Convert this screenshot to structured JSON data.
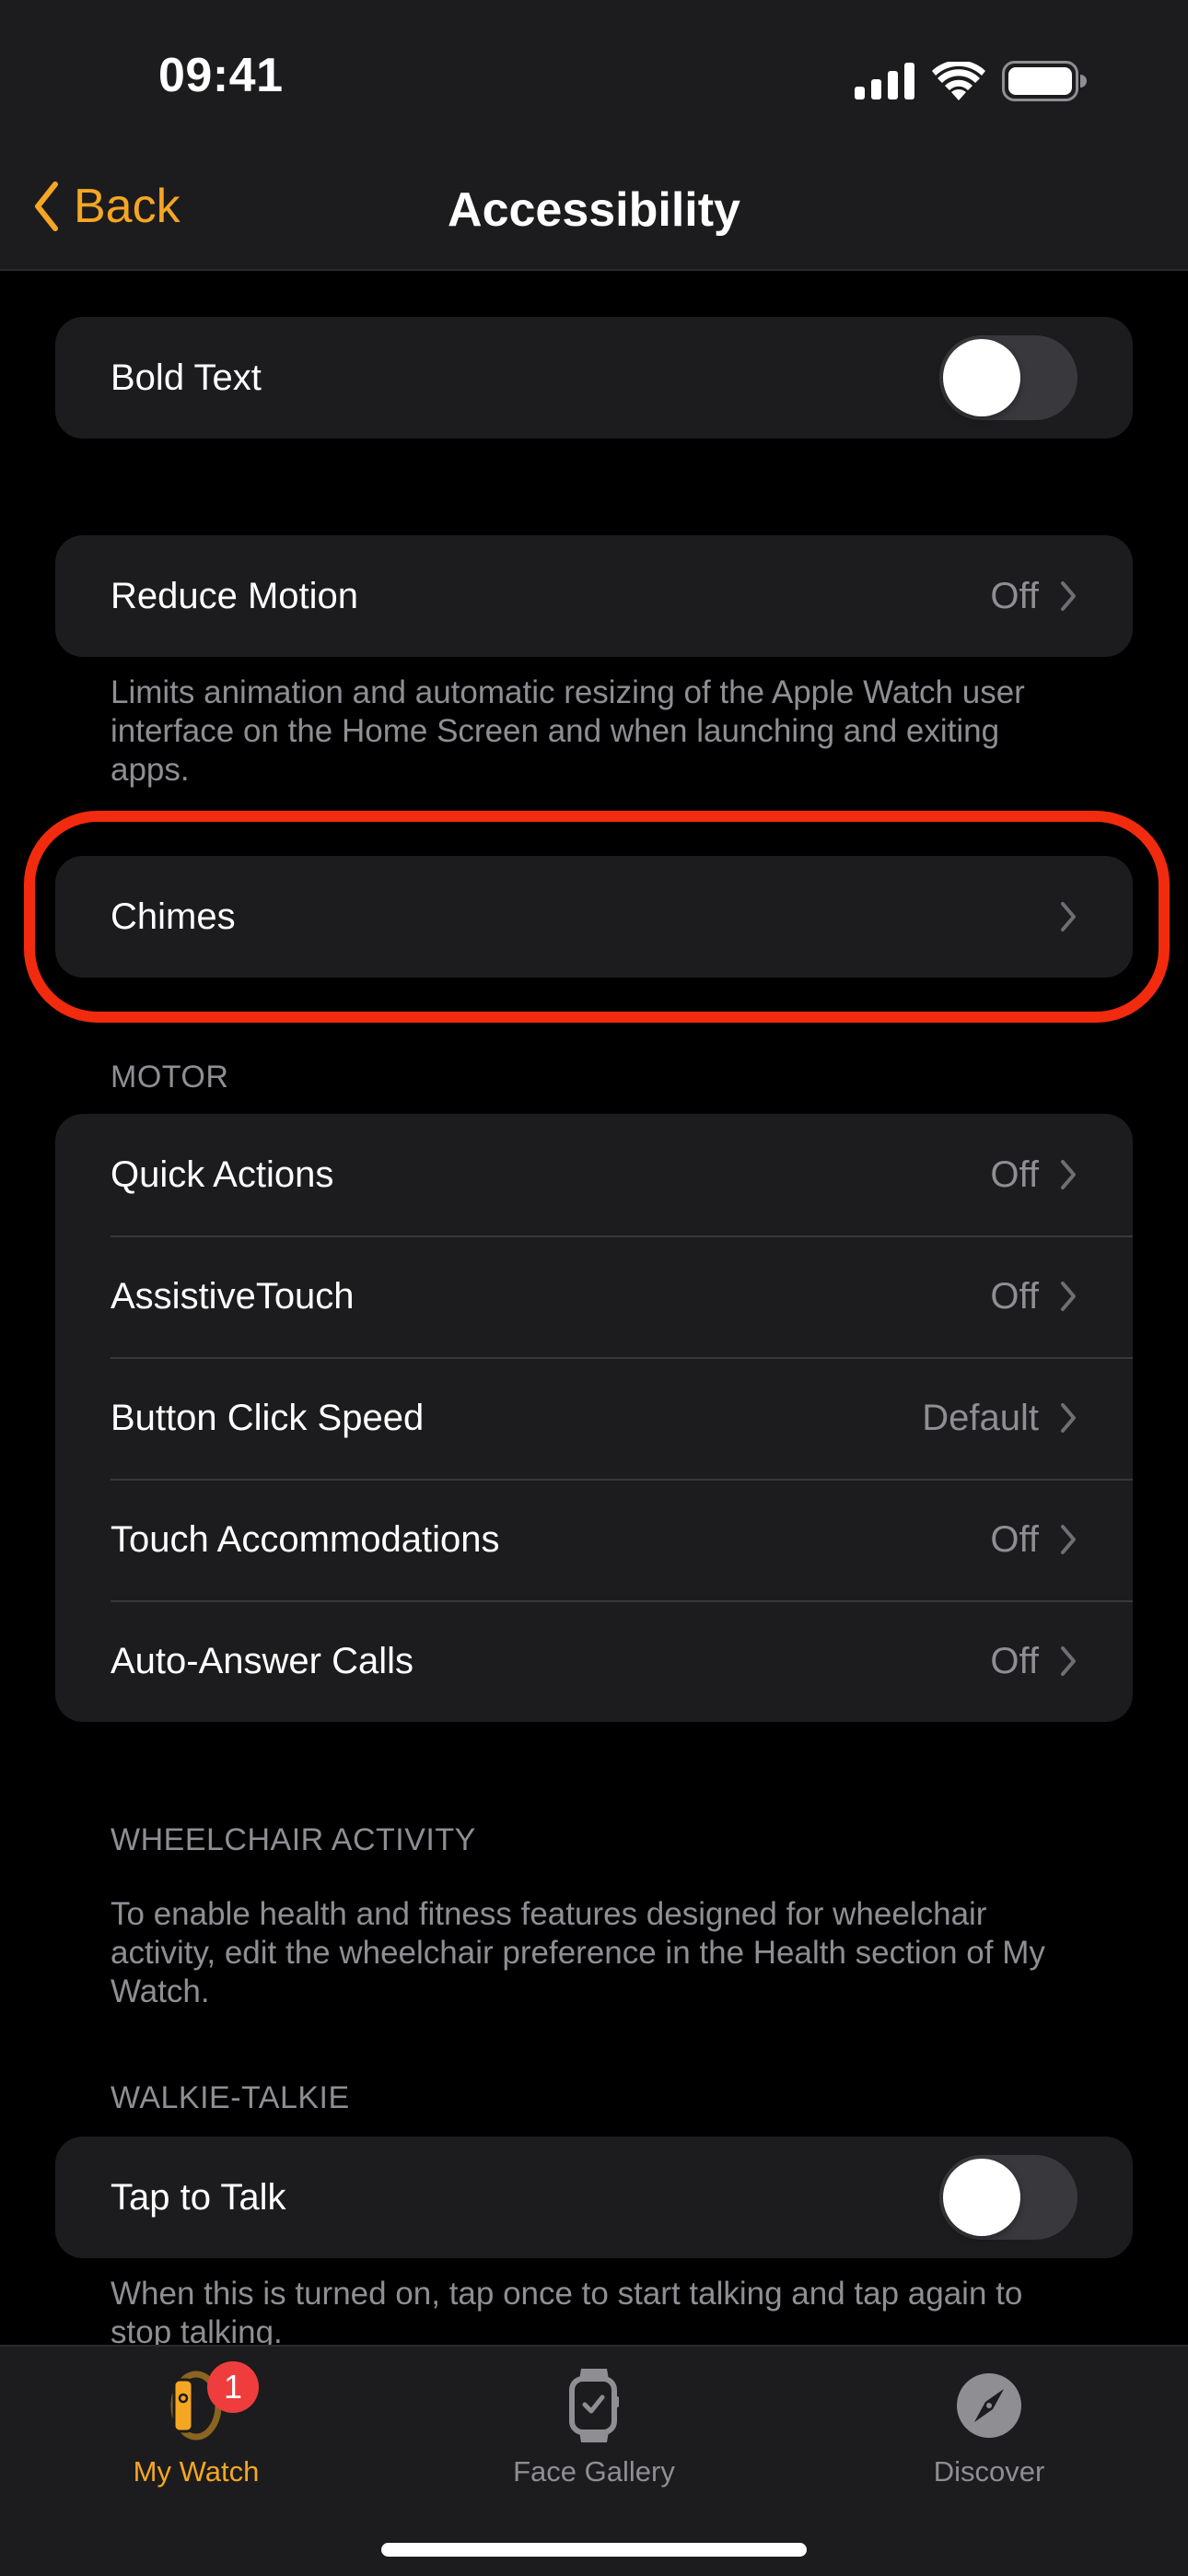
{
  "status_bar": {
    "time": "09:41",
    "icons": [
      "cellular-signal-icon",
      "wifi-icon",
      "battery-icon"
    ]
  },
  "nav": {
    "back_label": "Back",
    "title": "Accessibility"
  },
  "colors": {
    "accent": "#f5a623",
    "highlight": "#f22b0e",
    "badge": "#ef3d3d",
    "secondary_text": "#8e8e93",
    "cell_bg": "#1c1c1e"
  },
  "bold_text": {
    "label": "Bold Text",
    "enabled": false
  },
  "reduce_motion": {
    "label": "Reduce Motion",
    "value": "Off",
    "footer": "Limits animation and automatic resizing of the Apple Watch user interface on the Home Screen and when launching and exiting apps."
  },
  "chimes": {
    "label": "Chimes",
    "highlighted": true
  },
  "motor": {
    "header": "MOTOR",
    "items": [
      {
        "label": "Quick Actions",
        "value": "Off"
      },
      {
        "label": "AssistiveTouch",
        "value": "Off"
      },
      {
        "label": "Button Click Speed",
        "value": "Default"
      },
      {
        "label": "Touch Accommodations",
        "value": "Off"
      },
      {
        "label": "Auto-Answer Calls",
        "value": "Off"
      }
    ]
  },
  "wheelchair": {
    "header": "WHEELCHAIR ACTIVITY",
    "footer": "To enable health and fitness features designed for wheelchair activity, edit the wheelchair preference in the Health section of My Watch."
  },
  "walkie_talkie": {
    "header": "WALKIE-TALKIE",
    "tap_to_talk_label": "Tap to Talk",
    "enabled": false,
    "footer": "When this is turned on, tap once to start talking and tap again to stop talking."
  },
  "tabbar": {
    "tabs": [
      {
        "label": "My Watch",
        "icon": "my-watch-icon",
        "active": true,
        "badge": "1"
      },
      {
        "label": "Face Gallery",
        "icon": "face-gallery-icon",
        "active": false
      },
      {
        "label": "Discover",
        "icon": "compass-icon",
        "active": false
      }
    ]
  }
}
